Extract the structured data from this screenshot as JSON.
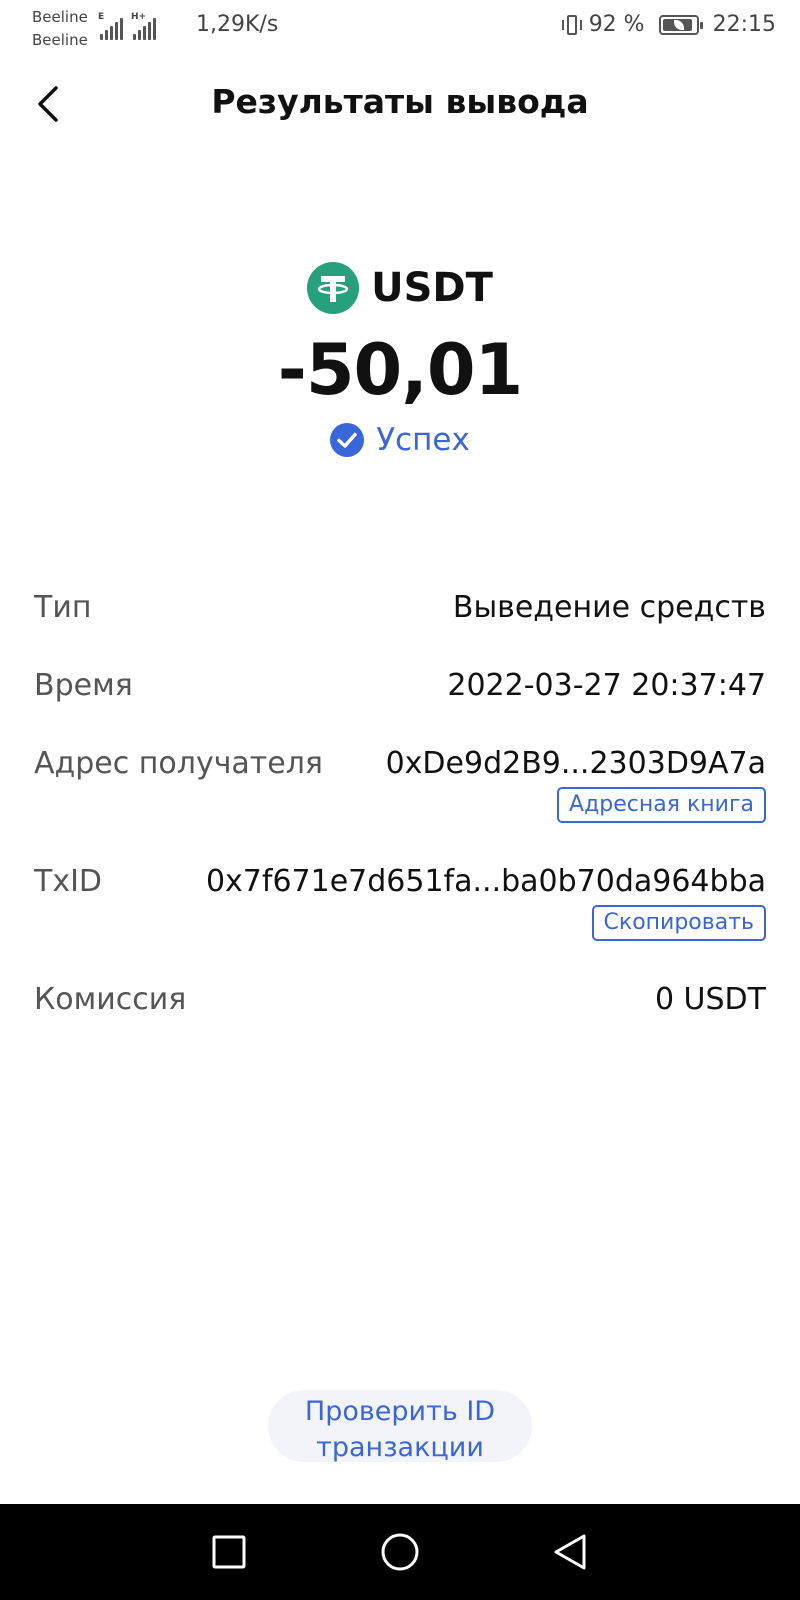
{
  "status_bar": {
    "carrier_1": "Beeline",
    "carrier_2": "Beeline",
    "network_1": "E",
    "network_2": "H+",
    "net_speed": "1,29K/s",
    "battery_percent": "92 %",
    "battery_level": 0.92,
    "time": "22:15"
  },
  "header": {
    "title": "Результаты вывода"
  },
  "summary": {
    "asset": "USDT",
    "amount": "-50,01",
    "status": "Успех"
  },
  "details": {
    "type_label": "Тип",
    "type_value": "Выведение средств",
    "time_label": "Время",
    "time_value": "2022-03-27 20:37:47",
    "address_label": "Адрес получателя",
    "address_value": "0xDe9d2B9...2303D9A7a",
    "address_book_label": "Адресная книга",
    "txid_label": "TxID",
    "txid_value": "0x7f671e7d651fa...ba0b70da964bba",
    "copy_label": "Скопировать",
    "fee_label": "Комиссия",
    "fee_value": "0 USDT"
  },
  "actions": {
    "verify_label": "Проверить ID транзакции"
  },
  "colors": {
    "accent": "#3a66d9",
    "tether": "#26a17b",
    "nav_bar": "#000000"
  },
  "icons": {
    "back": "chevron-left-icon",
    "asset": "tether-icon",
    "status": "check-circle-icon",
    "nav_recent": "square-icon",
    "nav_home": "circle-icon",
    "nav_back": "triangle-back-icon"
  }
}
